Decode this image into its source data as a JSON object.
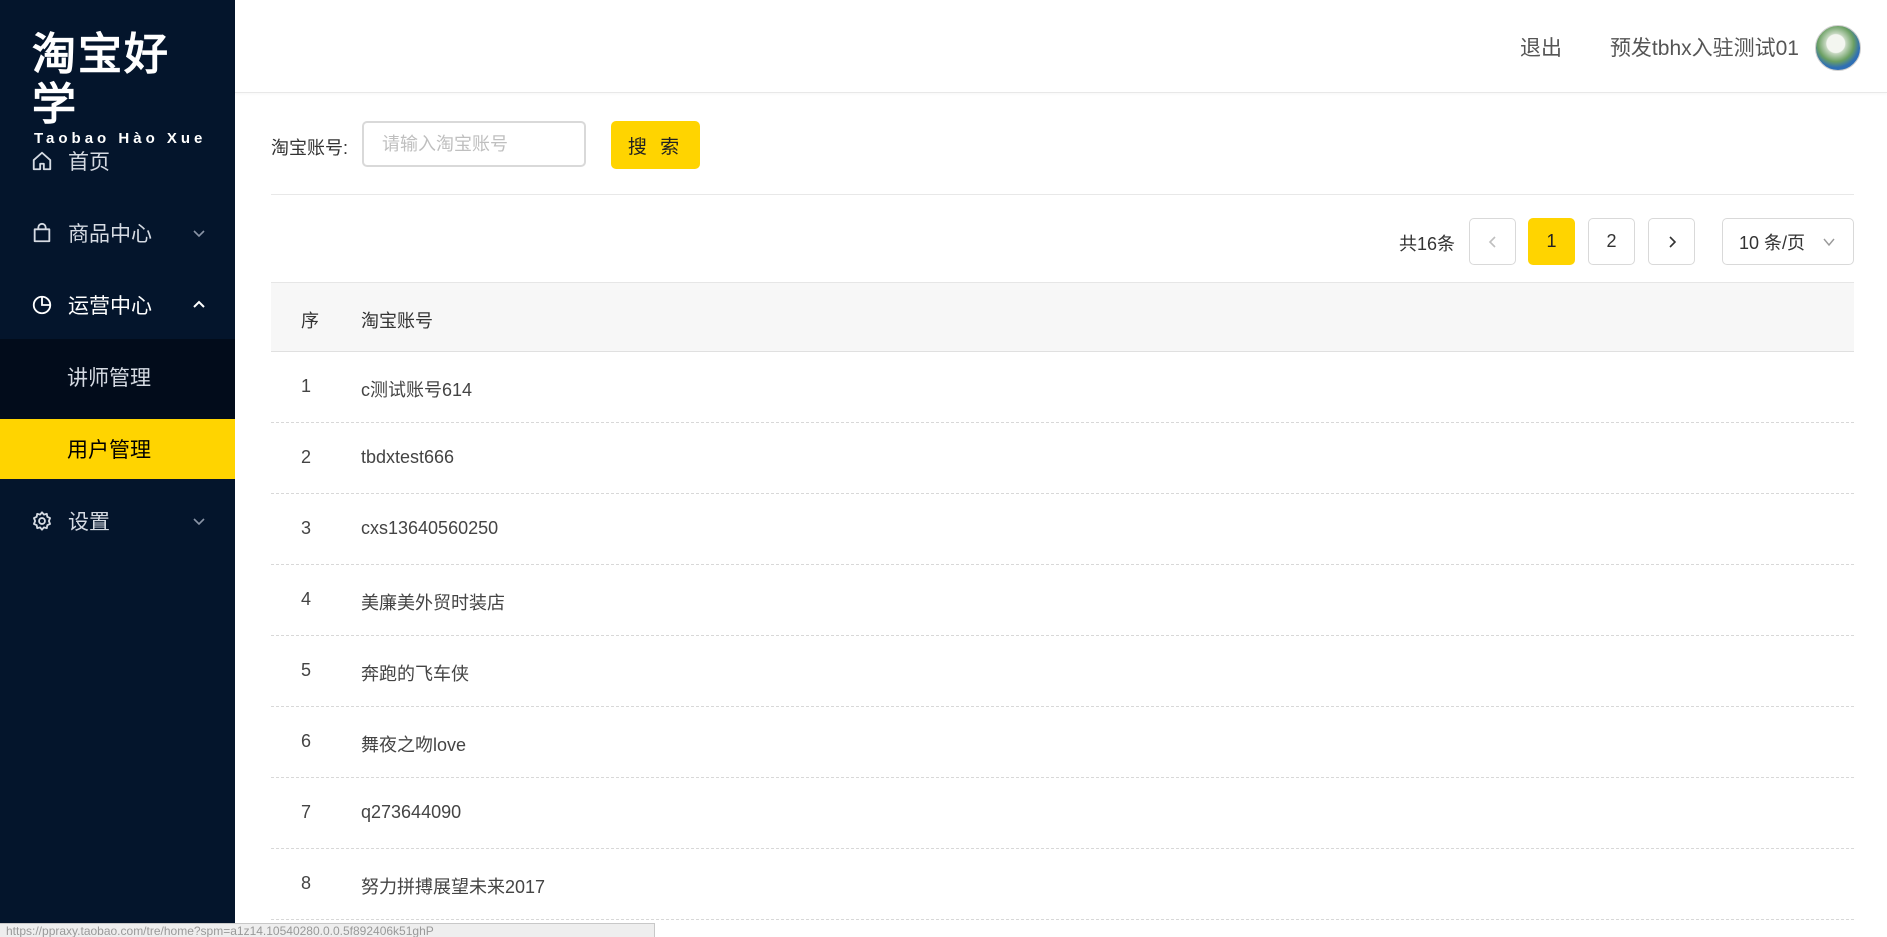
{
  "logo": {
    "cn": "淘宝好学",
    "en": "Taobao Hào Xue"
  },
  "sidebar": {
    "items": [
      {
        "label": "首页",
        "icon": "home-icon"
      },
      {
        "label": "商品中心",
        "icon": "shopping-bag-icon"
      },
      {
        "label": "运营中心",
        "icon": "pie-chart-icon"
      },
      {
        "label": "设置",
        "icon": "gear-icon"
      }
    ],
    "submenu": [
      {
        "label": "讲师管理",
        "active": false
      },
      {
        "label": "用户管理",
        "active": true
      }
    ]
  },
  "header": {
    "logout": "退出",
    "username": "预发tbhx入驻测试01"
  },
  "search": {
    "label": "淘宝账号:",
    "placeholder": "请输入淘宝账号",
    "value": "",
    "button": "搜 索"
  },
  "pagination": {
    "total": "共16条",
    "pages": [
      "1",
      "2"
    ],
    "current": "1",
    "page_size": "10 条/页"
  },
  "table": {
    "headers": [
      "序",
      "淘宝账号"
    ],
    "rows": [
      [
        "1",
        "c测试账号614"
      ],
      [
        "2",
        "tbdxtest666"
      ],
      [
        "3",
        "cxs13640560250"
      ],
      [
        "4",
        "美廉美外贸时装店"
      ],
      [
        "5",
        "奔跑的飞车侠"
      ],
      [
        "6",
        "舞夜之吻love"
      ],
      [
        "7",
        "q273644090"
      ],
      [
        "8",
        "努力拼搏展望未来2017"
      ]
    ]
  },
  "status_bar": "https://ppraxy.taobao.com/tre/home?spm=a1z14.10540280.0.0.5f892406k51ghP",
  "colors": {
    "sidebar_bg": "#04152c",
    "accent": "#ffd400"
  }
}
